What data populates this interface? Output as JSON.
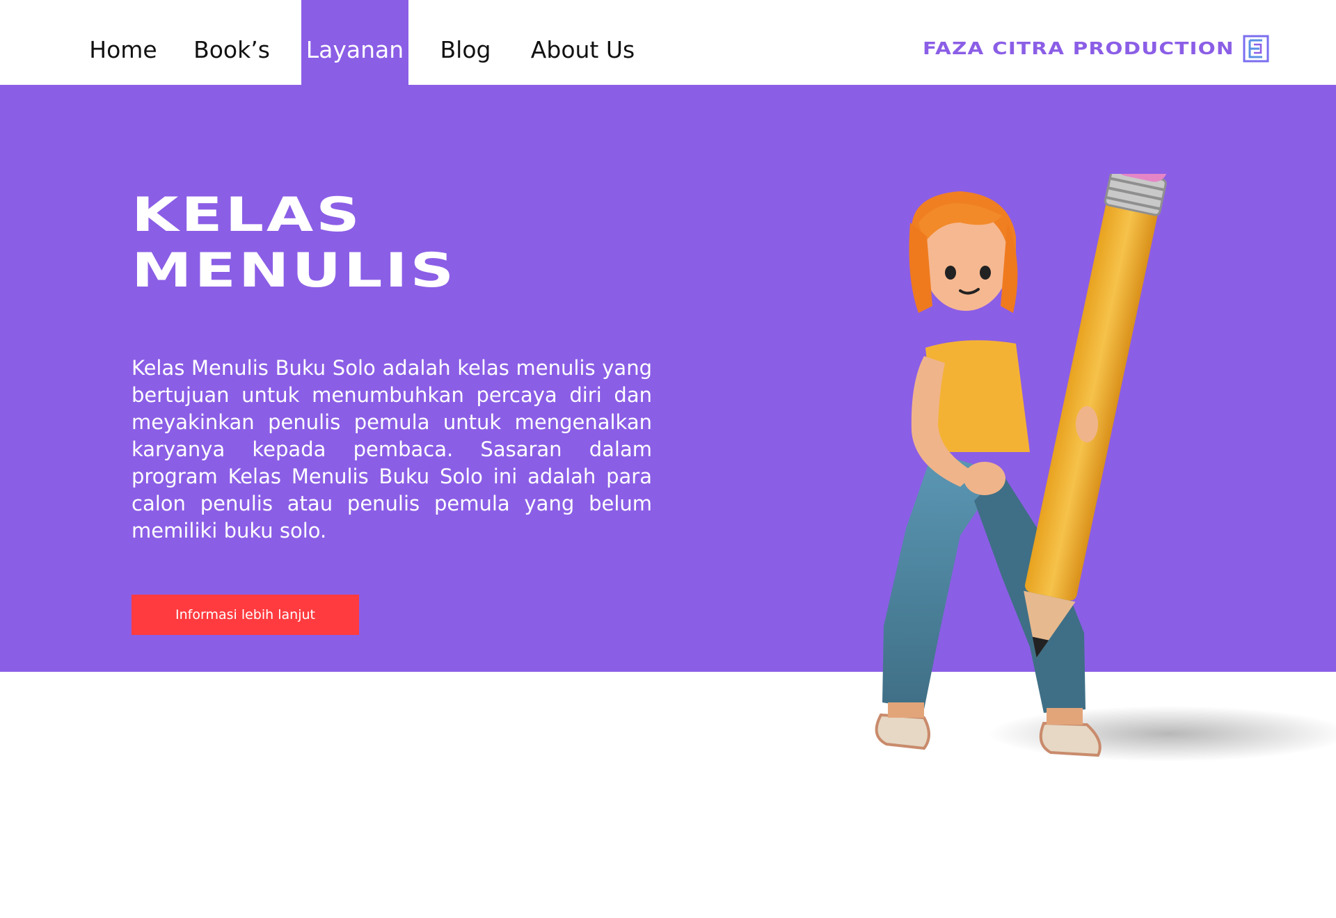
{
  "nav": {
    "items": [
      {
        "label": "Home"
      },
      {
        "label": "Book’s"
      },
      {
        "label": "Layanan",
        "active": true
      },
      {
        "label": "Blog"
      },
      {
        "label": "About Us"
      }
    ],
    "brand": "FAZA CITRA PRODUCTION",
    "brand_icon": "fcp-logo-icon"
  },
  "hero": {
    "title_line1": "KELAS",
    "title_line2": "MENULIS",
    "description": "Kelas Menulis Buku Solo adalah kelas menulis yang bertujuan untuk menumbuhkan percaya diri dan meyakinkan penulis pemula untuk mengenalkan karyanya kepada pembaca. Sasaran dalam program Kelas Menulis Buku Solo ini adalah para calon penulis atau penulis pemula yang belum memiliki buku solo.",
    "cta_label": "Informasi lebih lanjut",
    "illustration": "girl-holding-pencil-illustration"
  },
  "colors": {
    "accent": "#8b5ee6",
    "cta": "#ff3b3f",
    "text_dark": "#111111"
  }
}
